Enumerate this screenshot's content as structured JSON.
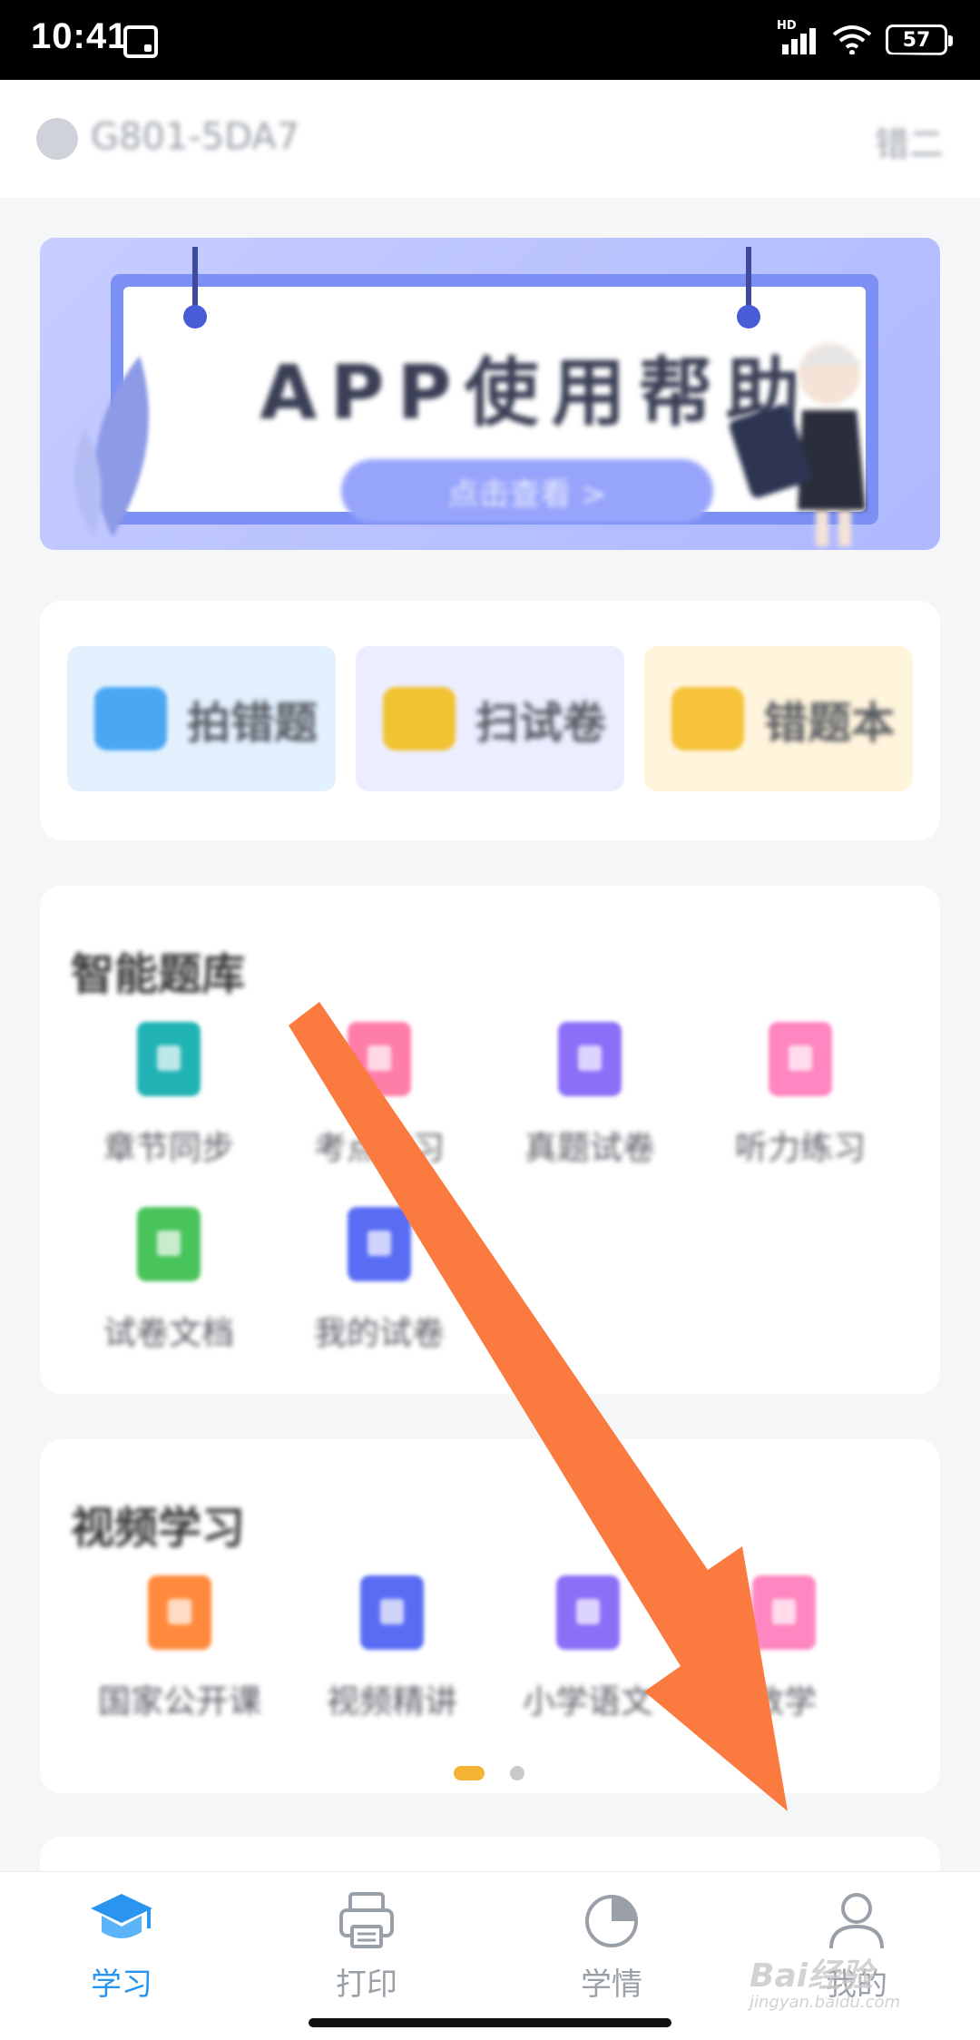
{
  "status_bar": {
    "time": "10:41",
    "signal_label": "HD",
    "battery": "57"
  },
  "header": {
    "device_id": "G801-5DA7",
    "right_link": "错二"
  },
  "banner": {
    "title": "APP使用帮助",
    "cta": "点击查看 >"
  },
  "quick_actions": [
    {
      "label": "拍错题",
      "icon": "camera-icon",
      "bg": "#e3f1ff",
      "icon_color": "#4aa7f2"
    },
    {
      "label": "扫试卷",
      "icon": "scan-icon",
      "bg": "#eceeff",
      "icon_color": "#f1c232"
    },
    {
      "label": "错题本",
      "icon": "book-icon",
      "bg": "#fff4dc",
      "icon_color": "#f6c23a"
    }
  ],
  "library": {
    "title": "智能题库",
    "items": [
      {
        "label": "章节同步",
        "icon": "chapter-sync-icon",
        "color": "#21b3b4"
      },
      {
        "label": "考点练习",
        "icon": "topic-practice-icon",
        "color": "#ff7ea8"
      },
      {
        "label": "真题试卷",
        "icon": "real-paper-icon",
        "color": "#8b6ff7"
      },
      {
        "label": "听力练习",
        "icon": "listening-icon",
        "color": "#ff86c0"
      },
      {
        "label": "试卷文档",
        "icon": "paper-doc-icon",
        "color": "#49c45a"
      },
      {
        "label": "我的试卷",
        "icon": "my-paper-icon",
        "color": "#5a6cf4"
      }
    ]
  },
  "video": {
    "title": "视频学习",
    "items": [
      {
        "label": "国家公开课",
        "icon": "open-class-icon",
        "color": "#ff8a3d"
      },
      {
        "label": "视频精讲",
        "icon": "video-lecture-icon",
        "color": "#5a6cf4"
      },
      {
        "label": "小学语文",
        "icon": "chinese-icon",
        "color": "#8b6ff7"
      },
      {
        "label": "数学",
        "icon": "math-icon",
        "color": "#ff86c0"
      }
    ]
  },
  "tabs": [
    {
      "label": "学习",
      "icon": "graduation-cap-icon",
      "active": true
    },
    {
      "label": "打印",
      "icon": "printer-icon",
      "active": false
    },
    {
      "label": "学情",
      "icon": "pie-chart-icon",
      "active": false
    },
    {
      "label": "我的",
      "icon": "user-icon",
      "active": false
    }
  ],
  "watermark": {
    "brand": "Bai经验",
    "url": "jingyan.baidu.com"
  },
  "colors": {
    "accent": "#2a95ef",
    "arrow": "#fb7a3f",
    "page_dot_active": "#f5b333"
  }
}
